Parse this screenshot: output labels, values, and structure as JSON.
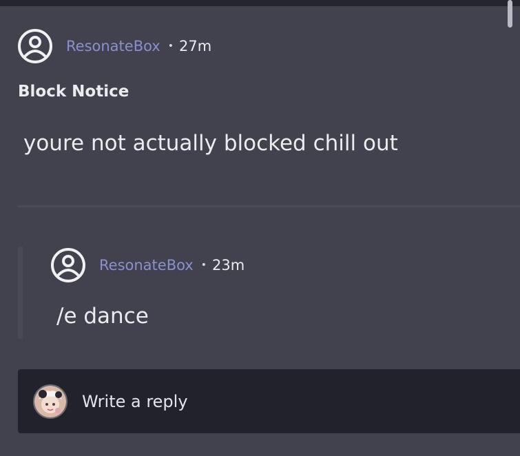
{
  "post": {
    "author": "ResonateBox",
    "separator": "•",
    "time": "27m",
    "title": "Block Notice",
    "body": "youre not actually blocked chill out",
    "author_icon": "user-circle-icon"
  },
  "reply": {
    "author": "ResonateBox",
    "separator": "•",
    "time": "23m",
    "body": "/e dance",
    "author_icon": "user-circle-icon"
  },
  "composer": {
    "placeholder": "Write a reply",
    "avatar_icon": "anime-avatar-icon"
  },
  "colors": {
    "background": "#42424e",
    "username": "#8b8fd0",
    "composer_bg": "#22222d"
  }
}
